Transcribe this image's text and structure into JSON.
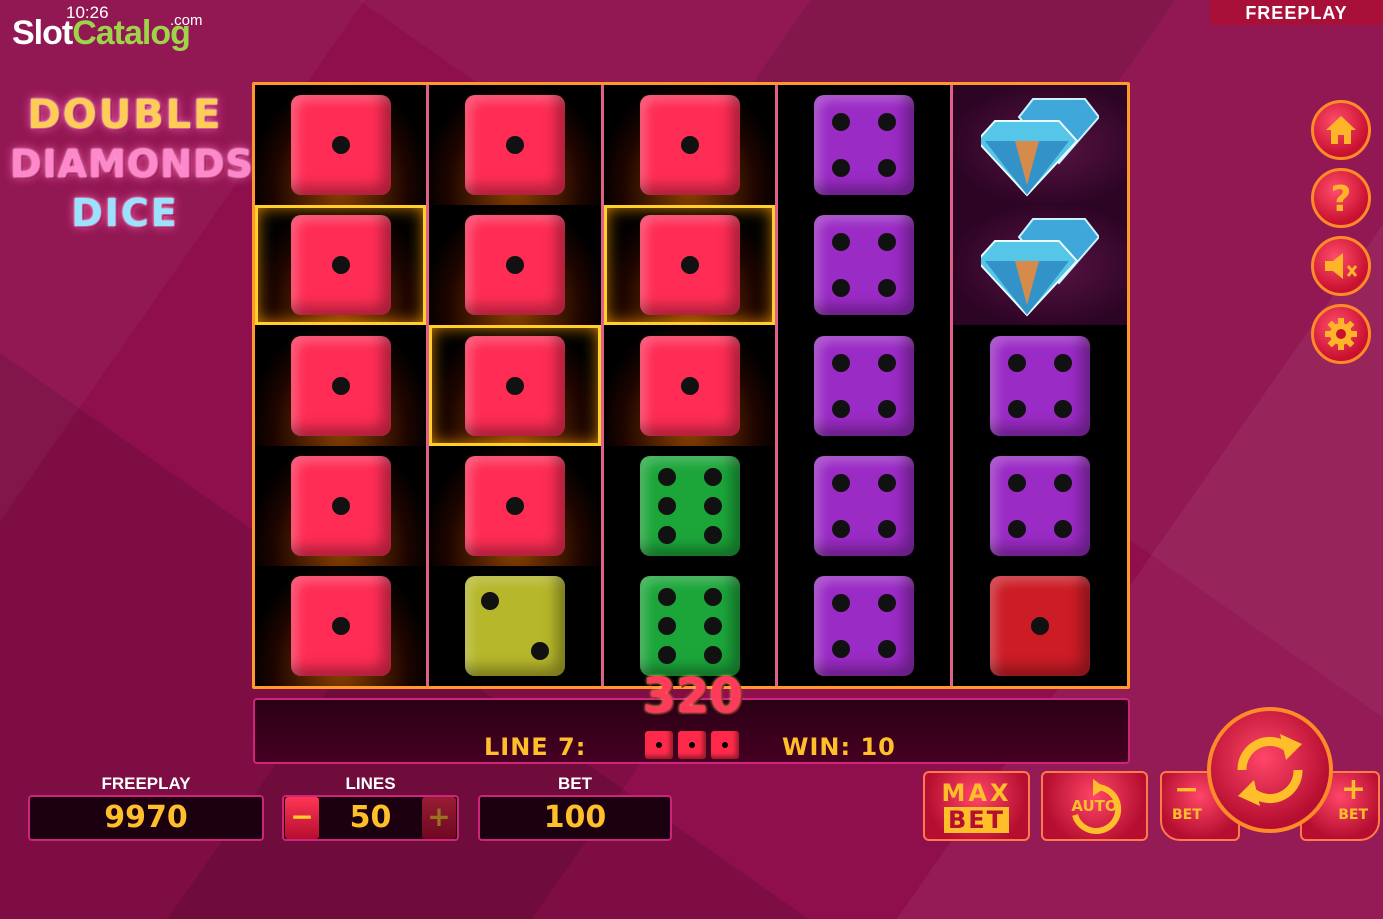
{
  "status": {
    "time": "10:26"
  },
  "brand": {
    "part1": "Slot",
    "part2": "Catalog",
    "suffix": ".com"
  },
  "mode_banner": "FREEPLAY",
  "game_title": {
    "line1": "DOUBLE",
    "line2": "DIAMONDS",
    "line3": "DICE"
  },
  "reels": [
    [
      "red-die-1",
      "red-die-1",
      "red-die-1",
      "red-die-1",
      "red-die-1"
    ],
    [
      "red-die-1",
      "red-die-1",
      "red-die-1",
      "red-die-1",
      "yellow-die-2"
    ],
    [
      "red-die-1",
      "red-die-1",
      "red-die-1",
      "green-die-6",
      "green-die-6"
    ],
    [
      "purple-die-4",
      "purple-die-4",
      "purple-die-4",
      "purple-die-4",
      "purple-die-4"
    ],
    [
      "double-diamond",
      "double-diamond",
      "purple-die-4",
      "purple-die-4",
      "darkred-die-1"
    ]
  ],
  "win_amount": "320",
  "message": {
    "line_label": "LINE 7:",
    "win_label": "WIN: 10"
  },
  "balance": {
    "label": "FREEPLAY",
    "value": "9970"
  },
  "lines": {
    "label": "LINES",
    "value": "50",
    "minus": "−",
    "plus": "+"
  },
  "bet": {
    "label": "BET",
    "value": "100"
  },
  "buttons": {
    "max_bet_line1": "MAX",
    "max_bet_line2": "BET",
    "auto": "AUTO",
    "bet_minus_label": "BET",
    "bet_minus_sign": "−",
    "bet_plus_label": "BET",
    "bet_plus_sign": "+"
  },
  "side_icons": [
    "home-icon",
    "help-icon",
    "sound-muted-icon",
    "gear-icon"
  ],
  "colors": {
    "background": "#8e0f4c",
    "accent": "#ffbf2a",
    "reel_border": "#ff9a2a",
    "frame": "#d0247a"
  }
}
